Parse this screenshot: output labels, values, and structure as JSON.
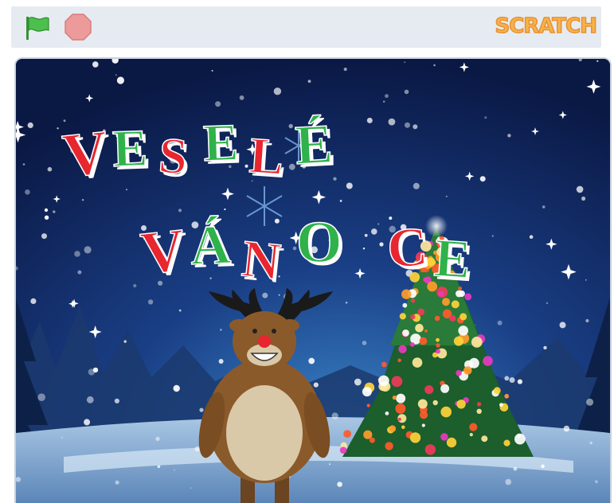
{
  "toolbar": {
    "green_flag_icon": "green-flag-icon",
    "stop_icon": "stop-icon",
    "logo_text": "SCRATCH"
  },
  "stage": {
    "greeting_line1": [
      "V",
      "E",
      "S",
      "E",
      "L",
      "É"
    ],
    "greeting_line2": [
      "V",
      "Á",
      "N",
      "O",
      "C",
      "E"
    ],
    "colors": {
      "red": "#e8262f",
      "green": "#2fb24a",
      "sky_top": "#0b1a48",
      "sky_bottom": "#2d6fb0"
    }
  }
}
